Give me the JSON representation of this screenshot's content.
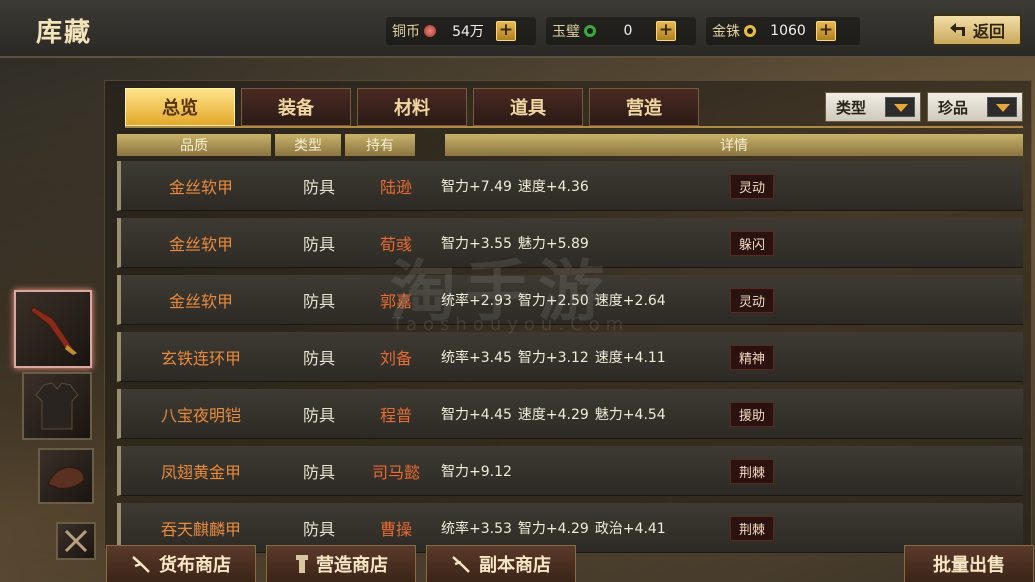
{
  "header": {
    "title": "库藏",
    "back_label": "返回"
  },
  "currencies": [
    {
      "label": "铜币",
      "value": "54万",
      "color": "#c0504a"
    },
    {
      "label": "玉璧",
      "value": "0",
      "color": "#3aa83a"
    },
    {
      "label": "金铢",
      "value": "1060",
      "color": "#e8c040"
    }
  ],
  "tabs": [
    "总览",
    "装备",
    "材料",
    "道具",
    "营造"
  ],
  "active_tab": 0,
  "filters": {
    "type_label": "类型",
    "rarity_label": "珍品"
  },
  "columns": {
    "quality": "品质",
    "type": "类型",
    "owner": "持有",
    "details": "详情"
  },
  "rows": [
    {
      "name": "金丝软甲",
      "type": "防具",
      "owner": "陆逊",
      "attrs": [
        "智力+7.49",
        "速度+4.36"
      ],
      "skill": "灵动"
    },
    {
      "name": "金丝软甲",
      "type": "防具",
      "owner": "荀彧",
      "attrs": [
        "智力+3.55",
        "魅力+5.89"
      ],
      "skill": "躲闪"
    },
    {
      "name": "金丝软甲",
      "type": "防具",
      "owner": "郭嘉",
      "attrs": [
        "统率+2.93",
        "智力+2.50",
        "速度+2.64"
      ],
      "skill": "灵动"
    },
    {
      "name": "玄铁连环甲",
      "type": "防具",
      "owner": "刘备",
      "attrs": [
        "统率+3.45",
        "智力+3.12",
        "速度+4.11"
      ],
      "skill": "精神"
    },
    {
      "name": "八宝夜明铠",
      "type": "防具",
      "owner": "程普",
      "attrs": [
        "智力+4.45",
        "速度+4.29",
        "魅力+4.54"
      ],
      "skill": "援助"
    },
    {
      "name": "凤翅黄金甲",
      "type": "防具",
      "owner": "司马懿",
      "attrs": [
        "智力+9.12"
      ],
      "skill": "荆棘"
    },
    {
      "name": "吞天麒麟甲",
      "type": "防具",
      "owner": "曹操",
      "attrs": [
        "统率+3.53",
        "智力+4.29",
        "政治+4.41"
      ],
      "skill": "荆棘"
    }
  ],
  "sidebar_icons": [
    "weapon-icon",
    "armor-icon",
    "mount-icon",
    "treasure-icon"
  ],
  "bottom_buttons": {
    "currency_shop": "货布商店",
    "build_shop": "营造商店",
    "dungeon_shop": "副本商店",
    "bulk_sell": "批量出售"
  },
  "watermark": {
    "text": "淘手游",
    "sub": "Taoshouyou.Com"
  }
}
